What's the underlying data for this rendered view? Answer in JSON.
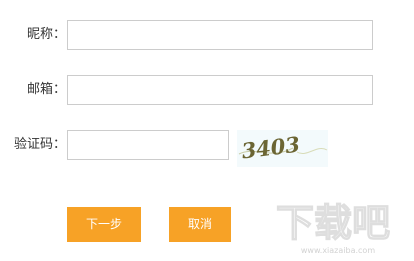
{
  "form": {
    "nickname_label": "昵称：",
    "nickname_value": "",
    "email_label": "邮箱：",
    "email_value": "",
    "captcha_label": "验证码：",
    "captcha_value": "",
    "captcha_image_text": "3403"
  },
  "buttons": {
    "next_label": "下一步",
    "cancel_label": "取消"
  },
  "watermark": {
    "brand_text": "下载吧",
    "url_text": "www.xiazaiba.com"
  },
  "colors": {
    "button_bg": "#f7a226",
    "button_text": "#ffffff",
    "field_border": "#cccccc",
    "captcha_bg": "#f3fafc",
    "captcha_glyph": "#6b6533"
  }
}
